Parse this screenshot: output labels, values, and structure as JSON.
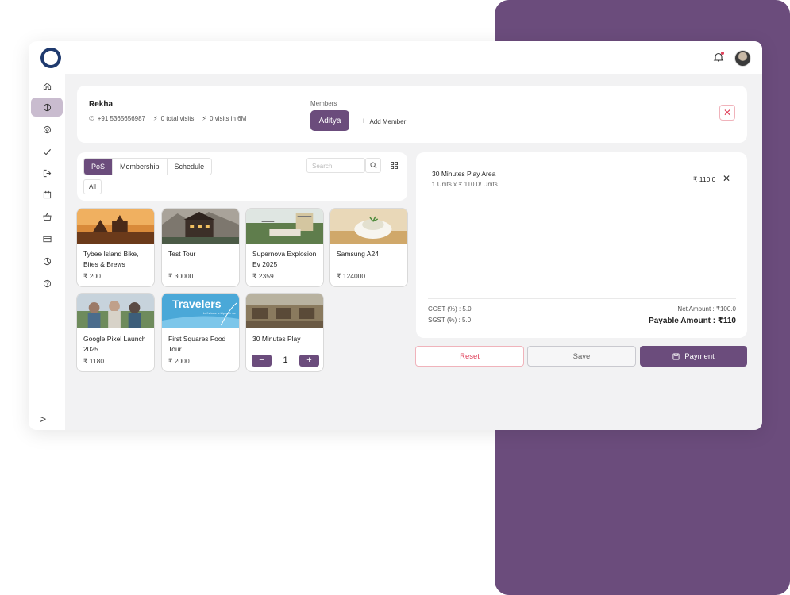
{
  "member": {
    "name": "Rekha",
    "phone": "+91 5365656987",
    "total_visits": "0 total visits",
    "recent_visits": "0 visits in 6M",
    "members_label": "Members",
    "member_chip": "Aditya",
    "add_member": "Add Member"
  },
  "catalog": {
    "tabs": [
      "PoS",
      "Membership",
      "Schedule"
    ],
    "active_tab": "PoS",
    "filter_all": "All",
    "search_placeholder": "Search"
  },
  "products": [
    {
      "title": "Tybee Island Bike, Bites & Brews",
      "price": "₹ 200"
    },
    {
      "title": "Test Tour",
      "price": "₹ 30000"
    },
    {
      "title": "Supernova Explosion Ev 2025",
      "price": "₹ 2359"
    },
    {
      "title": "Samsung A24",
      "price": "₹ 124000"
    },
    {
      "title": "Google Pixel Launch 2025",
      "price": "₹ 1180"
    },
    {
      "title": "First Squares Food Tour",
      "price": "₹ 2000"
    },
    {
      "title": "30 Minutes Play",
      "quantity": "1"
    }
  ],
  "product_image_text": {
    "banner_title": "Travelers",
    "banner_sub": "Let's take a trip with us"
  },
  "cart": {
    "item_name": "30 Minutes Play Area",
    "item_qty": "1",
    "item_detail": "Units x ₹ 110.0/ Units",
    "item_price": "₹ 110.0",
    "cgst": "CGST (%) : 5.0",
    "sgst": "SGST (%) : 5.0",
    "net_amount": "Net Amount : ₹100.0",
    "payable_amount": "Payable Amount : ₹110"
  },
  "actions": {
    "reset": "Reset",
    "save": "Save",
    "payment": "Payment"
  },
  "colors": {
    "brand": "#6b4c7c",
    "danger": "#e0405a",
    "background": "#f2f2f3"
  },
  "icons": [
    "home-icon",
    "pos-icon",
    "target-icon",
    "check-icon",
    "logout-icon",
    "calendar-icon",
    "basket-icon",
    "card-icon",
    "pie-chart-icon",
    "help-icon",
    "chevron-right-icon"
  ]
}
